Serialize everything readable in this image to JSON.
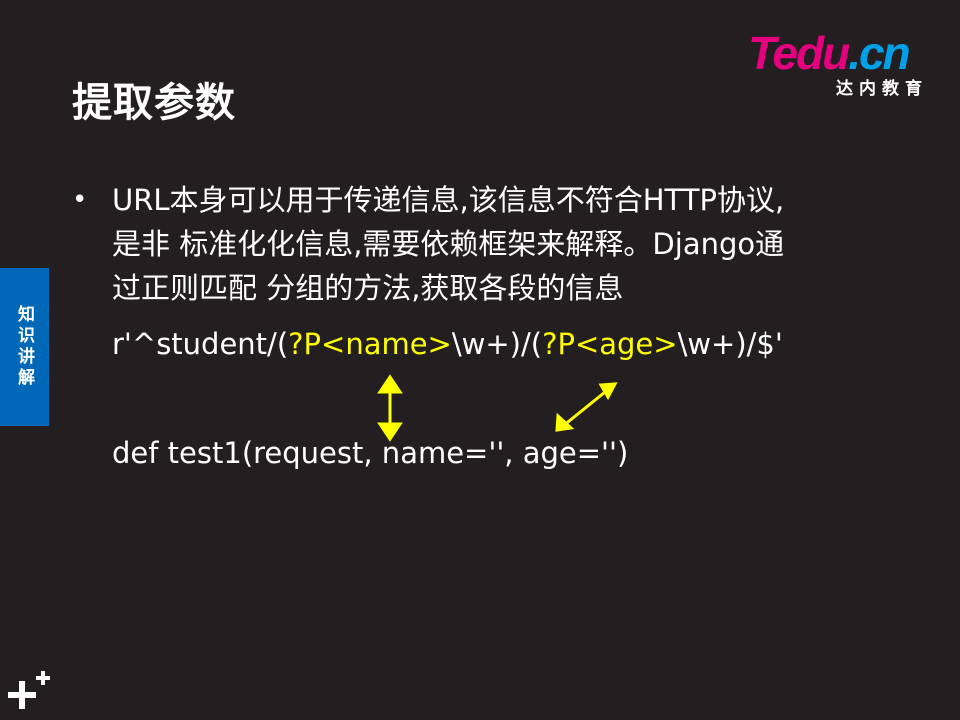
{
  "slide": {
    "title": "提取参数",
    "logo_wordmark": {
      "t": "T",
      "edu": "edu",
      "dot": ".",
      "cn": "cn"
    },
    "logo_subtitle": "达内教育",
    "side_tab_label": "知识讲解",
    "bullet_lines": [
      "URL本身可以用于传递信息,该信息不符合HTTP协议,",
      "是非 标准化化信息,需要依赖框架来解释。Django通",
      "过正则匹配 分组的方法,获取各段的信息"
    ],
    "regex_segments": {
      "prefix": "r'^student/(",
      "group1": "?P<name>",
      "mid": "\\w+)/(",
      "group2": "?P<age>",
      "suffix": "\\w+)/$'"
    },
    "def_line": "def test1(request, name='', age='')",
    "colors": {
      "background": "#231f20",
      "highlight": "#ffff00",
      "side_tab": "#0068b7",
      "logo_pink": "#e4007f",
      "logo_blue": "#00a0e9"
    },
    "icons": [
      "plus-logo-icon",
      "double-arrow-vertical-icon",
      "double-arrow-diagonal-icon"
    ]
  }
}
